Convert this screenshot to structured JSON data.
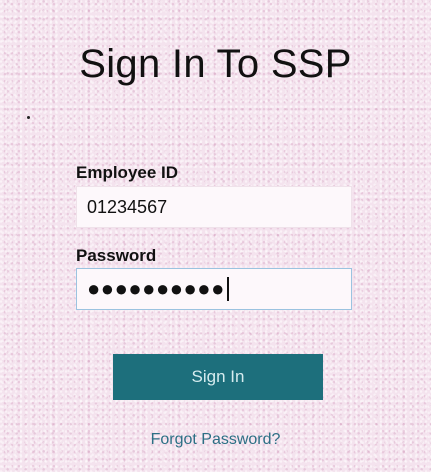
{
  "title": "Sign In To SSP",
  "employee_id": {
    "label": "Employee ID",
    "value": "01234567"
  },
  "password": {
    "label": "Password",
    "masked_value": "●●●●●●●●●●"
  },
  "sign_in_button": "Sign In",
  "forgot_password_link": "Forgot Password?",
  "colors": {
    "background": "#f4e3ee",
    "button": "#1d6f7c",
    "button_text": "#d6ecef",
    "link": "#2c6f85",
    "focused_border": "#9bc3e0"
  }
}
